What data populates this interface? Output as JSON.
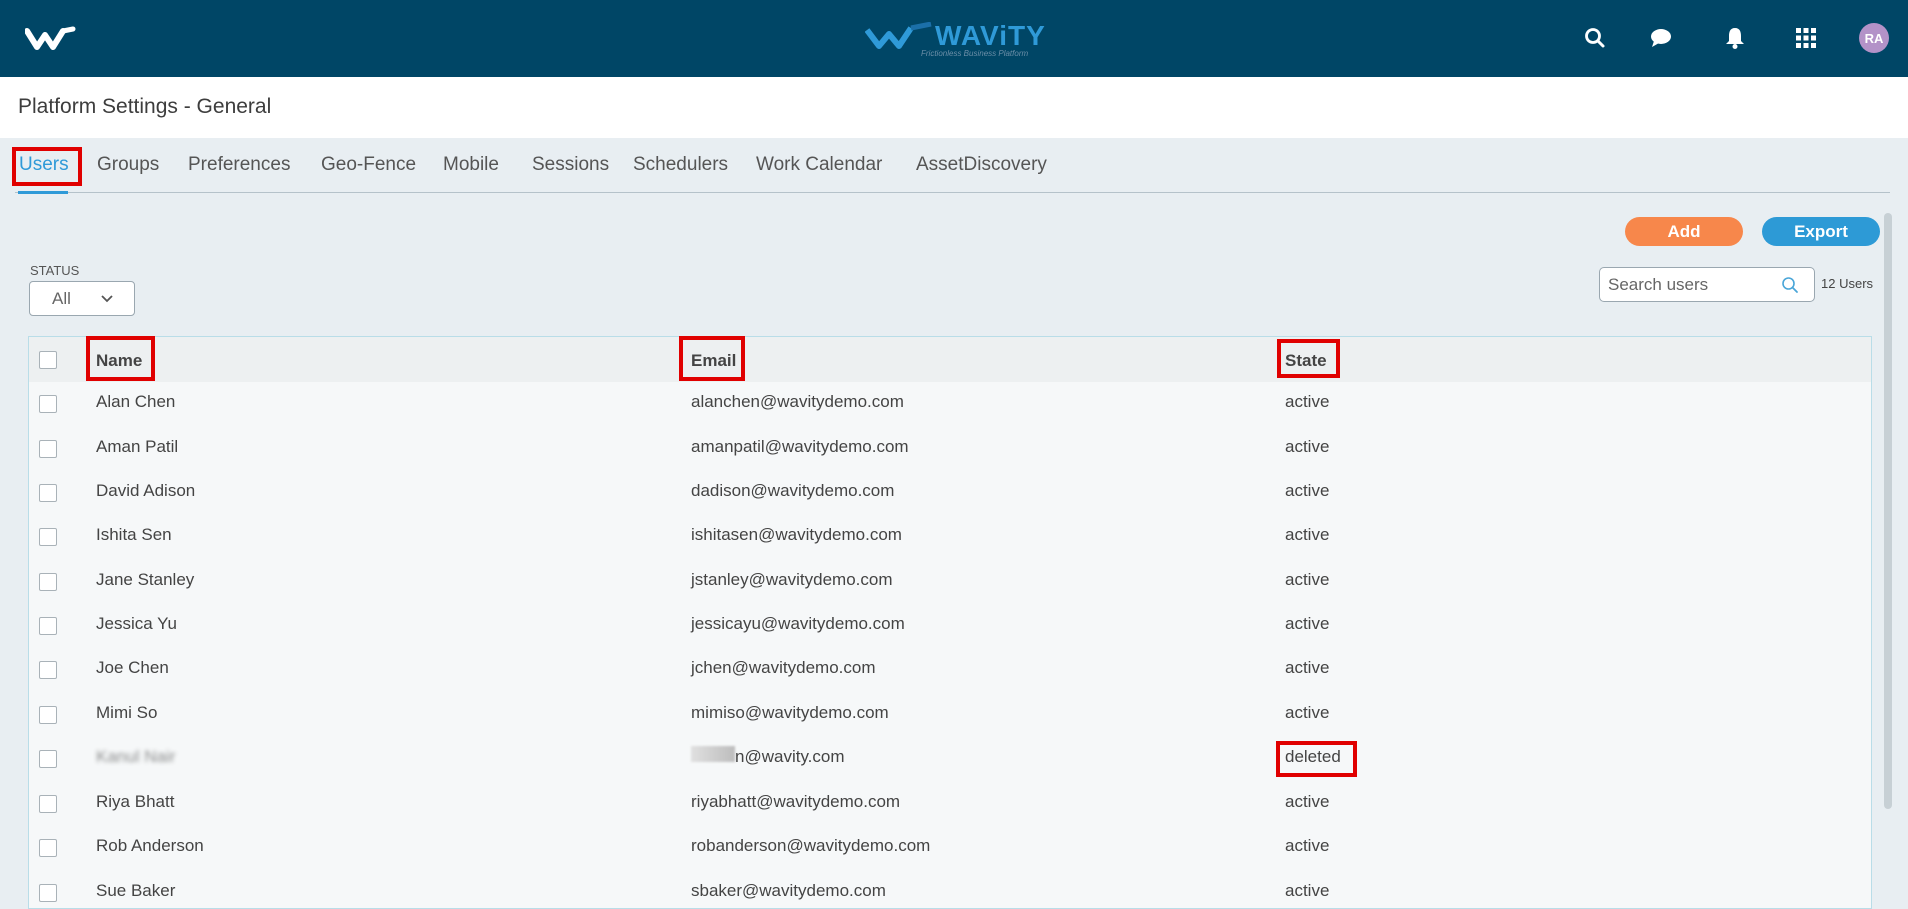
{
  "header": {
    "brand_name": "WAViTY",
    "brand_tagline": "Frictionless Business Platform",
    "avatar_initials": "RA",
    "icons": [
      "search-icon",
      "chat-icon",
      "bell-icon",
      "apps-grid-icon"
    ]
  },
  "page": {
    "title": "Platform Settings - General"
  },
  "tabs": [
    {
      "label": "Users",
      "active": true
    },
    {
      "label": "Groups"
    },
    {
      "label": "Preferences"
    },
    {
      "label": "Geo-Fence"
    },
    {
      "label": "Mobile"
    },
    {
      "label": "Sessions"
    },
    {
      "label": "Schedulers"
    },
    {
      "label": "Work Calendar"
    },
    {
      "label": "AssetDiscovery"
    }
  ],
  "actions": {
    "add_label": "Add",
    "export_label": "Export"
  },
  "filter": {
    "status_label": "STATUS",
    "status_value": "All"
  },
  "search": {
    "placeholder": "Search users",
    "count_text": "12 Users"
  },
  "table": {
    "columns": [
      "Name",
      "Email",
      "State"
    ],
    "rows": [
      {
        "name": "Alan Chen",
        "email": "alanchen@wavitydemo.com",
        "state": "active"
      },
      {
        "name": "Aman Patil",
        "email": "amanpatil@wavitydemo.com",
        "state": "active"
      },
      {
        "name": "David Adison",
        "email": "dadison@wavitydemo.com",
        "state": "active"
      },
      {
        "name": "Ishita Sen",
        "email": "ishitasen@wavitydemo.com",
        "state": "active"
      },
      {
        "name": "Jane Stanley",
        "email": "jstanley@wavitydemo.com",
        "state": "active"
      },
      {
        "name": "Jessica Yu",
        "email": "jessicayu@wavitydemo.com",
        "state": "active"
      },
      {
        "name": "Joe Chen",
        "email": "jchen@wavitydemo.com",
        "state": "active"
      },
      {
        "name": "Mimi So",
        "email": "mimiso@wavitydemo.com",
        "state": "active"
      },
      {
        "name": "Kanul Nair",
        "email": "n@wavity.com",
        "state": "deleted"
      },
      {
        "name": "Riya Bhatt",
        "email": "riyabhatt@wavitydemo.com",
        "state": "active"
      },
      {
        "name": "Rob Anderson",
        "email": "robanderson@wavitydemo.com",
        "state": "active"
      },
      {
        "name": "Sue Baker",
        "email": "sbaker@wavitydemo.com",
        "state": "active"
      }
    ]
  },
  "colors": {
    "header_bg": "#004666",
    "accent": "#2f9ad8",
    "add_button": "#f7874b",
    "highlight": "#e00000"
  }
}
